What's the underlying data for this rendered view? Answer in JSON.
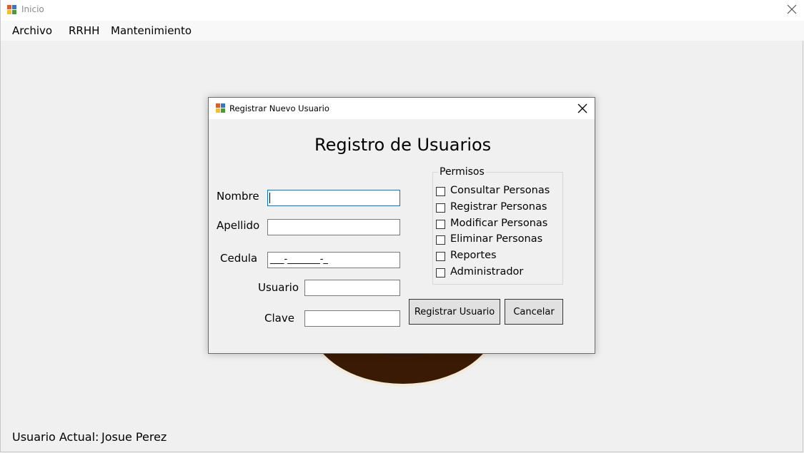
{
  "window": {
    "title": "Inicio"
  },
  "menu": {
    "items": [
      "Archivo",
      "RRHH",
      "Mantenimiento"
    ]
  },
  "status": {
    "label": "Usuario Actual:",
    "user": "Josue Perez"
  },
  "icons": {
    "app": "windows-form-icon",
    "close": "close-icon"
  },
  "colors": {
    "focus_border": "#0078d7",
    "background": "#f0f0f0"
  },
  "dialog": {
    "title": "Registrar Nuevo Usuario",
    "heading": "Registro de Usuarios",
    "fields": {
      "nombre": {
        "label": "Nombre",
        "value": ""
      },
      "apellido": {
        "label": "Apellido",
        "value": ""
      },
      "cedula": {
        "label": "Cedula",
        "value": "___-_______-_"
      },
      "usuario": {
        "label": "Usuario",
        "value": ""
      },
      "clave": {
        "label": "Clave",
        "value": ""
      }
    },
    "permisos": {
      "title": "Permisos",
      "items": [
        {
          "label": "Consultar Personas",
          "checked": false
        },
        {
          "label": "Registrar Personas",
          "checked": false
        },
        {
          "label": "Modificar Personas",
          "checked": false
        },
        {
          "label": "Eliminar Personas",
          "checked": false
        },
        {
          "label": "Reportes",
          "checked": false
        },
        {
          "label": "Administrador",
          "checked": false
        }
      ]
    },
    "buttons": {
      "register": "Registrar Usuario",
      "cancel": "Cancelar"
    }
  }
}
